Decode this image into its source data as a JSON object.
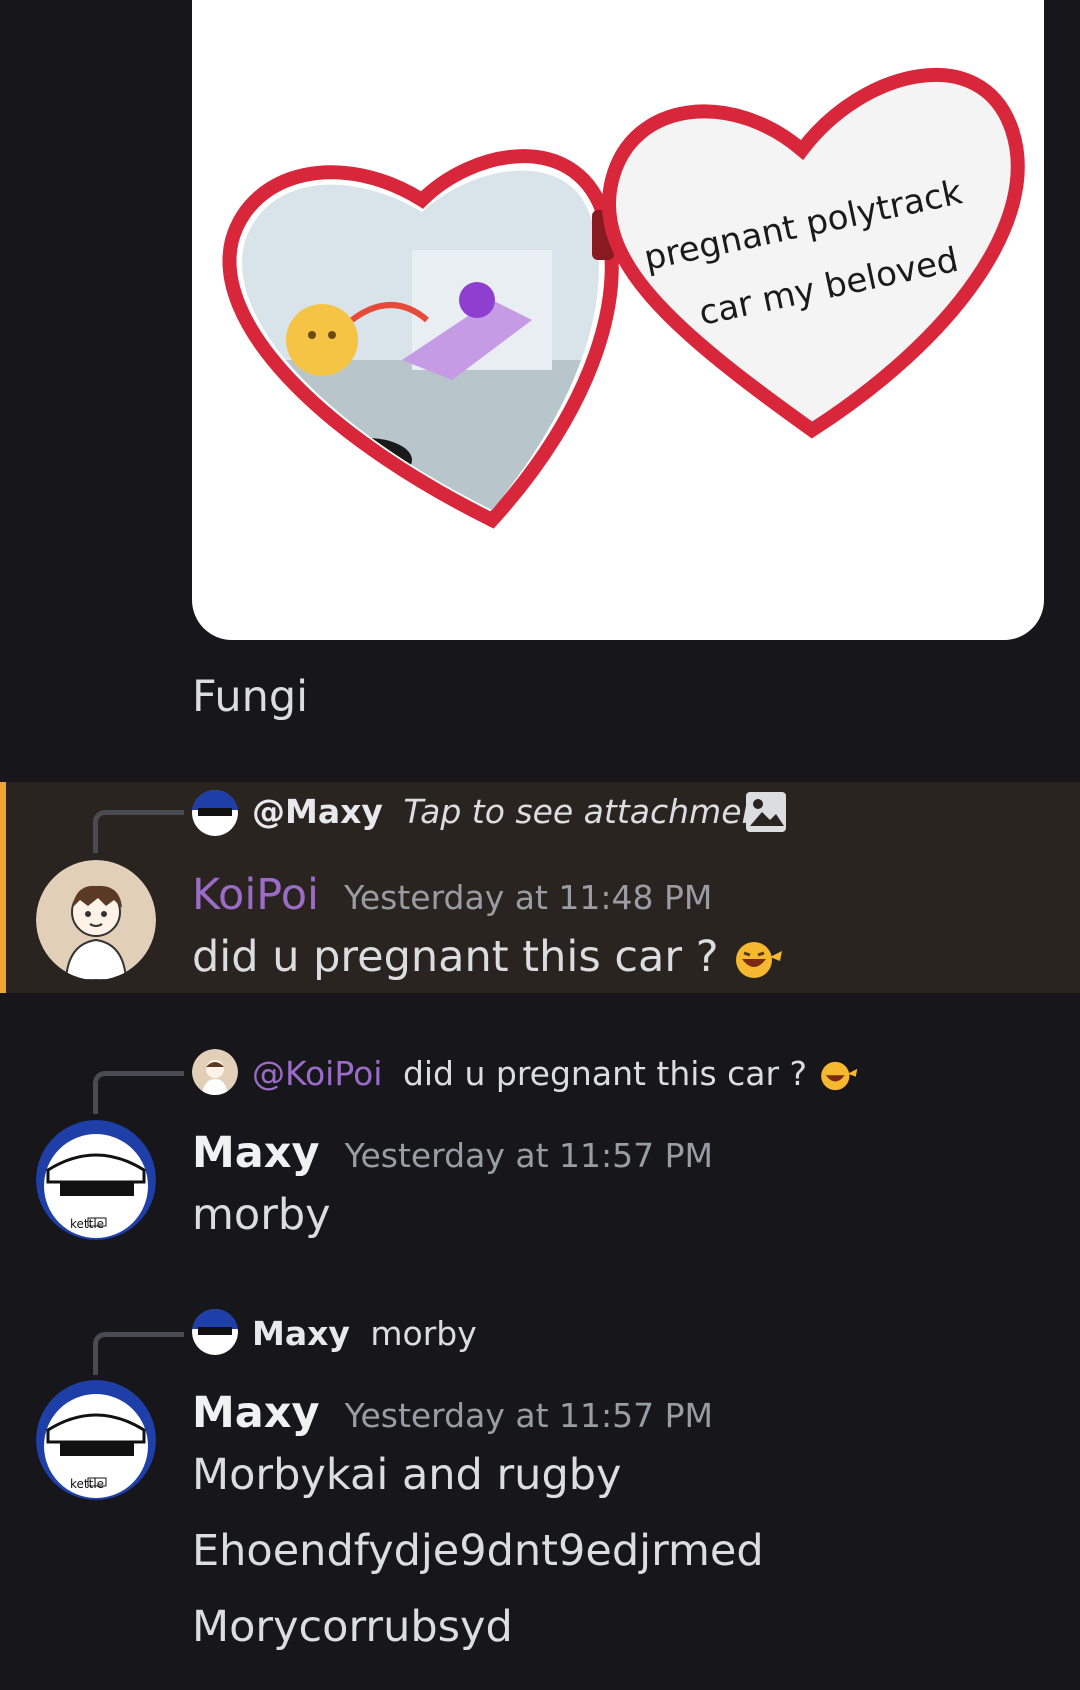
{
  "attachment": {
    "caption_line1": "pregnant polytrack",
    "caption_line2": "car my beloved"
  },
  "messages": [
    {
      "text": "Fungi"
    },
    {
      "reply": {
        "mention": "@Maxy",
        "preview": "Tap to see attachment"
      },
      "author": "KoiPoi",
      "author_color": "#9b6cc7",
      "timestamp": "Yesterday at 11:48 PM",
      "text": "did u pregnant this car ?"
    },
    {
      "reply": {
        "mention": "@KoiPoi",
        "preview": "did u pregnant this car ?"
      },
      "author": "Maxy",
      "timestamp": "Yesterday at 11:57 PM",
      "text": "morby"
    },
    {
      "reply": {
        "name": "Maxy",
        "preview": "morby"
      },
      "author": "Maxy",
      "timestamp": "Yesterday at 11:57 PM",
      "lines": [
        "Morbykai and rugby",
        "Ehoendfydje9dnt9edjrmed",
        "Morycorrubsyd"
      ]
    }
  ],
  "colors": {
    "background": "#16161b",
    "highlight_bg": "#2a2420",
    "highlight_bar": "#f0a532",
    "mention": "#9b6cc7"
  },
  "icons": [
    "image-icon",
    "laughing-emoji-icon"
  ]
}
